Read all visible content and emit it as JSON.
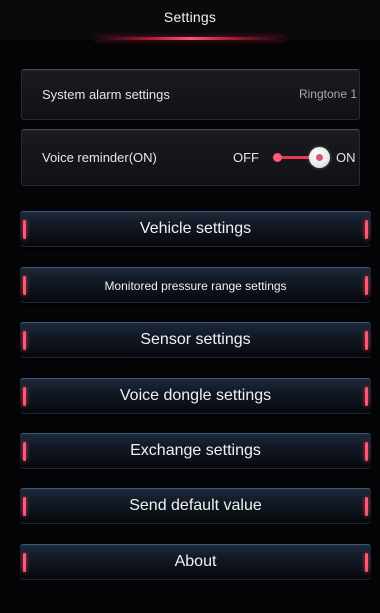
{
  "header": {
    "title": "Settings"
  },
  "alarm_setting": {
    "label": "System alarm settings",
    "value": "Ringtone 1"
  },
  "voice_reminder": {
    "label": "Voice reminder(ON)",
    "off_label": "OFF",
    "on_label": "ON",
    "state": "on"
  },
  "menu": {
    "items": [
      {
        "label": "Vehicle settings"
      },
      {
        "label": "Monitored pressure range settings"
      },
      {
        "label": "Sensor settings"
      },
      {
        "label": "Voice dongle settings"
      },
      {
        "label": "Exchange settings"
      },
      {
        "label": "Send default value"
      },
      {
        "label": "About"
      }
    ]
  },
  "colors": {
    "accent": "#e53a58",
    "background": "#050406",
    "button_top": "#3b5a7c"
  }
}
